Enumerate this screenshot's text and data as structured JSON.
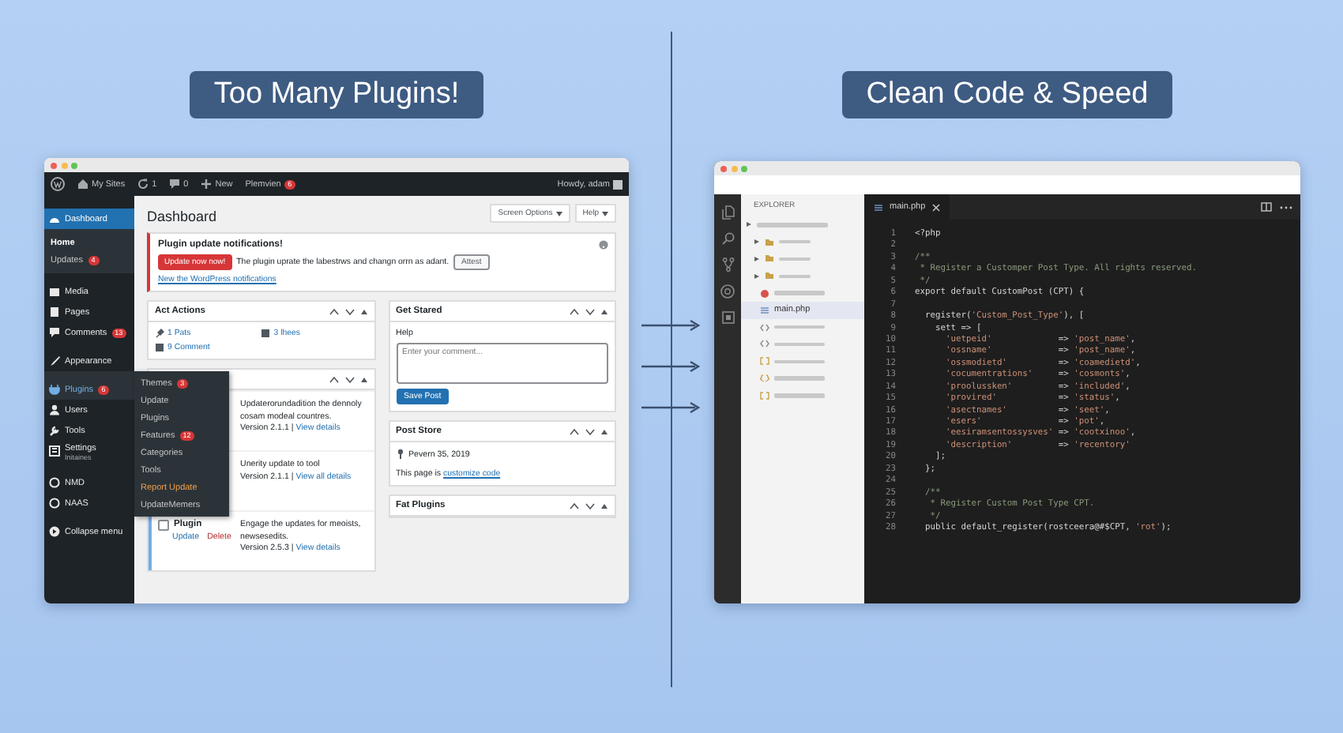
{
  "left": {
    "heading": "Too Many Plugins!",
    "window": {
      "admin_bar": {
        "items": [
          {
            "kind": "logo"
          },
          {
            "kind": "sites",
            "label": "My Sites"
          },
          {
            "kind": "updates",
            "label": "1"
          },
          {
            "kind": "comments",
            "label": "0"
          },
          {
            "kind": "new",
            "label": "New"
          },
          {
            "kind": "user",
            "label": "Plemvien",
            "badge": "6"
          }
        ],
        "greeting": "Howdy, adam"
      },
      "sidebar": {
        "groups": [
          [
            {
              "kind": "dashboard",
              "label": "Dashboard",
              "selected": true,
              "children": [
                {
                  "label": "Home",
                  "selected": true
                },
                {
                  "label": "Updates",
                  "badge": "4",
                  "selected": false
                }
              ]
            }
          ],
          [
            {
              "kind": "media",
              "label": "Media",
              "selected": false
            },
            {
              "kind": "pages",
              "label": "Pages",
              "selected": false
            },
            {
              "kind": "comments",
              "label": "Comments",
              "badge": "13",
              "selected": false
            }
          ],
          [
            {
              "kind": "appearance",
              "label": "Appearance",
              "selected": false
            },
            {
              "kind": "plugins",
              "label": "Plugins",
              "badge": "6",
              "selected": false,
              "expanded": true,
              "children": [
                {
                  "label": "Themes",
                  "badge": "3",
                  "selected": false
                },
                {
                  "label": "Update",
                  "selected": false
                },
                {
                  "label": "Plugins",
                  "selected": false
                },
                {
                  "label": "Features",
                  "badge": "12",
                  "selected": false
                },
                {
                  "label": "Categories",
                  "selected": false
                },
                {
                  "label": "Tools",
                  "selected": false
                },
                {
                  "label": "Report Update",
                  "selected": true
                },
                {
                  "label": "UpdateMemers",
                  "selected": false
                }
              ]
            },
            {
              "kind": "users",
              "label": "Users",
              "selected": false
            },
            {
              "kind": "tools",
              "label": "Tools",
              "selected": false
            },
            {
              "kind": "settings",
              "label": "Settings",
              "subtitle": "Initaines",
              "selected": false
            }
          ],
          [
            {
              "kind": "generic",
              "label": "NMD",
              "selected": false
            },
            {
              "kind": "generic",
              "label": "NAAS",
              "selected": false
            }
          ],
          [
            {
              "kind": "collapse",
              "label": "Collapse menu",
              "selected": false
            }
          ]
        ]
      },
      "page": {
        "title": "Dashboard",
        "buttons": [
          {
            "label": "Screen Options"
          },
          {
            "label": "Help"
          }
        ],
        "notice": {
          "title": "Plugin update notifications!",
          "button": "Update now now!",
          "text": "The plugin uprate the labestrws and changn orrn as adant.",
          "secondary_button": "Attest",
          "link": "New the WordPress notifications"
        },
        "columns": [
          [
            {
              "kind": "links",
              "title": "Act Actions",
              "links": [
                {
                  "label": "1 Pats"
                },
                {
                  "label": "3 lhees"
                },
                {
                  "label": "9 Comment"
                }
              ]
            },
            {
              "kind": "plugins",
              "rows": [
                {
                  "description": "Updaterorundadition the dennoly cosam modeal countres.",
                  "version": "Version 2.1.1 |",
                  "link": "View details"
                },
                {
                  "description": "Unerity update to tool",
                  "version": "Version 2.1.1 |",
                  "link": "View all details"
                },
                {
                  "name": "Plugin",
                  "checked": false,
                  "actions": [
                    "Update",
                    "Delete"
                  ],
                  "description": "Engage the updates for meoists, newsesedits.",
                  "version": "Version 2.5.3 |",
                  "link": "View details"
                }
              ]
            }
          ],
          [
            {
              "kind": "form",
              "title": "Get Stared",
              "label": "Help",
              "placeholder": "Enter your comment...",
              "button": "Save Post"
            },
            {
              "kind": "post",
              "title": "Post Store",
              "date": "Pevern 35, 2019",
              "text": "This page is",
              "link": "customize code"
            },
            {
              "kind": "empty",
              "title": "Fat Plugins"
            }
          ]
        ]
      }
    }
  },
  "right": {
    "heading": "Clean Code & Speed",
    "window": {
      "explorer": {
        "title": "EXPLORER",
        "items": [
          {
            "kind": "root",
            "selected": false
          },
          {
            "kind": "folder",
            "selected": false
          },
          {
            "kind": "folder",
            "selected": false
          },
          {
            "kind": "folder",
            "selected": false
          },
          {
            "kind": "package",
            "selected": false
          },
          {
            "kind": "file",
            "label": "main.php",
            "selected": true
          },
          {
            "kind": "code",
            "selected": false
          },
          {
            "kind": "code",
            "selected": false
          },
          {
            "kind": "data",
            "selected": false
          },
          {
            "kind": "json",
            "selected": false
          },
          {
            "kind": "data",
            "selected": false
          }
        ]
      },
      "tab": {
        "label": "main.php"
      },
      "lines": [
        {
          "number": "1",
          "kind": "code",
          "text": "<?php"
        },
        {
          "number": "2"
        },
        {
          "number": "3",
          "kind": "comment",
          "text": "/**"
        },
        {
          "number": "4",
          "kind": "comment",
          "text": " * Register a Customper Post Type. All rights reserved."
        },
        {
          "number": "5",
          "kind": "comment",
          "text": " */"
        },
        {
          "number": "6",
          "kind": "code",
          "text": "export default CustomPost (CPT) {"
        },
        {
          "number": "7"
        },
        {
          "number": "8",
          "kind": "code",
          "text": "  register('Custom_Post_Type'), ["
        },
        {
          "number": "9",
          "kind": "code",
          "text": "    sett => ["
        },
        {
          "number": "10",
          "kind": "code",
          "text": "      'uetpeid'             => 'post_name',"
        },
        {
          "number": "11",
          "kind": "code",
          "text": "      'ossname'             => 'post_name',"
        },
        {
          "number": "12",
          "kind": "code",
          "text": "      'ossmodietd'          => 'coamedietd',"
        },
        {
          "number": "13",
          "kind": "code",
          "text": "      'cocumentrations'     => 'cosmonts',"
        },
        {
          "number": "14",
          "kind": "code",
          "text": "      'proolussken'         => 'included',"
        },
        {
          "number": "15",
          "kind": "code",
          "text": "      'provired'            => 'status',"
        },
        {
          "number": "16",
          "kind": "code",
          "text": "      'asectnames'          => 'seet',"
        },
        {
          "number": "17",
          "kind": "code",
          "text": "      'esers'               => 'pot',"
        },
        {
          "number": "18",
          "kind": "code",
          "text": "      'eesiramsentossysves' => 'cootxinoo',"
        },
        {
          "number": "19",
          "kind": "code",
          "text": "      'description'         => 'recentory'"
        },
        {
          "number": "20",
          "kind": "code",
          "text": "    ];"
        },
        {
          "number": "23",
          "kind": "code",
          "text": "  };"
        },
        {
          "number": "24"
        },
        {
          "number": "25",
          "kind": "comment",
          "text": "  /**"
        },
        {
          "number": "26",
          "kind": "comment",
          "text": "   * Register Custom Post Type CPT."
        },
        {
          "number": "27",
          "kind": "comment",
          "text": "   */"
        },
        {
          "number": "28",
          "kind": "code",
          "text": "  public default_register(rostceera@#$CPT, 'rot');"
        }
      ]
    }
  }
}
